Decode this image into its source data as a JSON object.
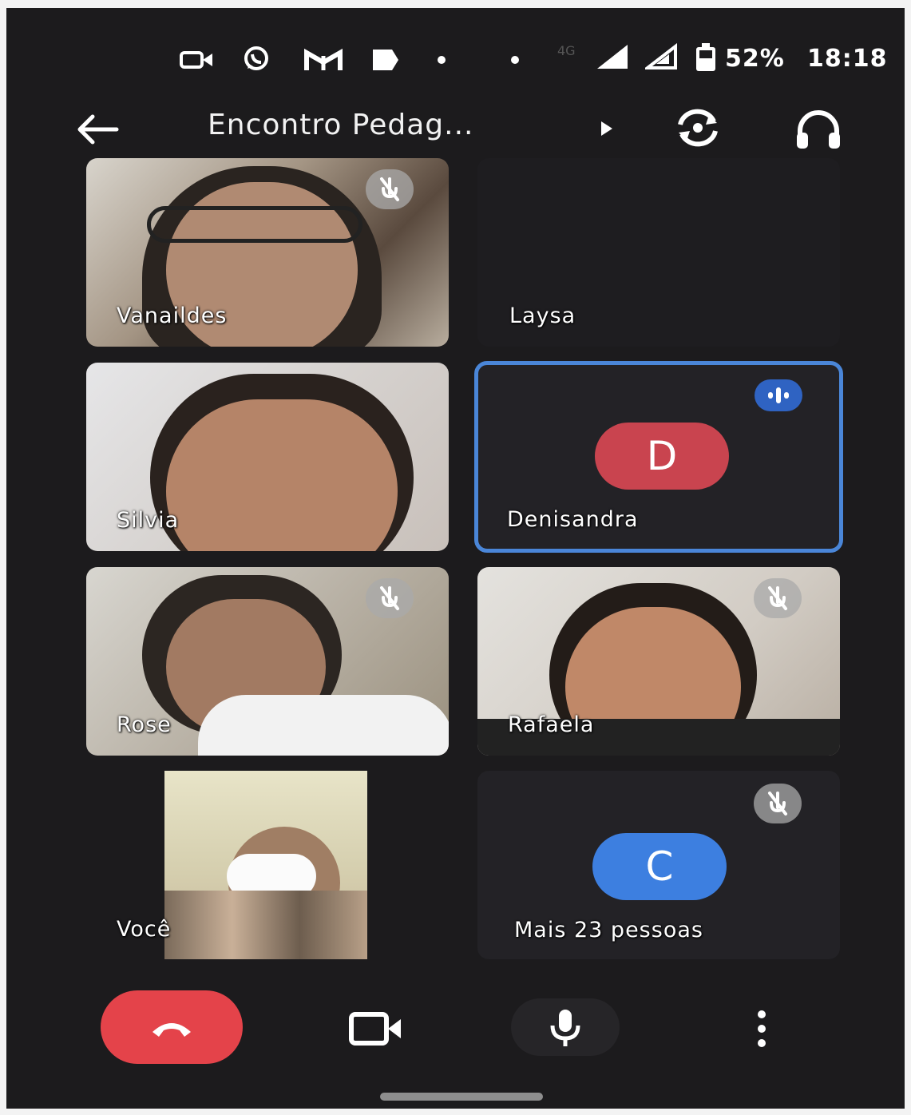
{
  "status_bar": {
    "network": "4G",
    "battery": "52%",
    "time": "18:18",
    "icons": [
      "video-camera-icon",
      "whatsapp-icon",
      "gmail-icon",
      "notification-icon",
      "signal-icon",
      "signal-2-icon",
      "battery-icon"
    ]
  },
  "meeting": {
    "title": "Encontro Pedag..."
  },
  "participants": [
    {
      "name": "Vanaildes",
      "muted": true,
      "video": true
    },
    {
      "name": "Laysa",
      "muted": false,
      "video": false
    },
    {
      "name": "Silvia",
      "muted": false,
      "video": true
    },
    {
      "name": "Denisandra",
      "muted": false,
      "video": false,
      "speaking": true,
      "initial": "D",
      "avatar_color": "#c9444f"
    },
    {
      "name": "Rose",
      "muted": true,
      "video": true
    },
    {
      "name": "Rafaela",
      "muted": true,
      "video": true
    },
    {
      "name": "Você",
      "muted": false,
      "video": true,
      "self": true
    },
    {
      "name": "Mais 23 pessoas",
      "muted": true,
      "video": false,
      "initial": "C",
      "avatar_color": "#3d7fe0"
    }
  ],
  "colors": {
    "background": "#1c1b1d",
    "hangup": "#e4434a",
    "active_speaker_border": "#4a86d8",
    "tile_dark": "#232226"
  }
}
